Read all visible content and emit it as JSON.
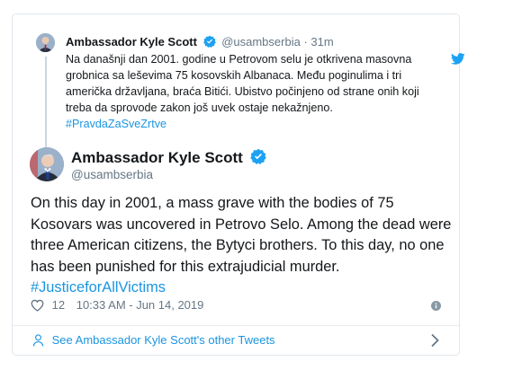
{
  "quoted_tweet": {
    "author_name": "Ambassador Kyle Scott",
    "handle": "@usambserbia",
    "separator": "·",
    "time": "31m",
    "text": "Na današnji dan 2001. godine u Petrovom selu je otkrivena masovna grobnica sa leševima 75 kosovskih Albanaca. Među poginulima i tri američka državljana, braća Bitići. Ubistvo počinjeno od strane onih koji treba da sprovode zakon još uvek ostaje nekažnjeno. ",
    "hashtag": "#PravdaZaSveZrtve"
  },
  "tweet": {
    "author_name": "Ambassador Kyle Scott",
    "handle": "@usambserbia",
    "text": "On this day in 2001, a mass grave with the bodies of 75 Kosovars was uncovered in Petrovo Selo. Among the dead were three American citizens, the Bytyci brothers. To this day, no one has been punished for this extrajudicial murder.",
    "hashtag": "#JusticeforAllVictims",
    "likes": "12",
    "timestamp": "10:33 AM - Jun 14, 2019"
  },
  "footer": {
    "link_text": "See Ambassador Kyle Scott's other Tweets"
  },
  "icons": {
    "verified": "verified-badge-icon",
    "bird": "twitter-bird-icon",
    "heart": "heart-icon",
    "info": "info-icon",
    "person": "person-icon",
    "chevron": "chevron-right-icon"
  },
  "colors": {
    "link": "#1b95e0",
    "secondary_text": "#657786",
    "border": "#e1e8ed"
  }
}
